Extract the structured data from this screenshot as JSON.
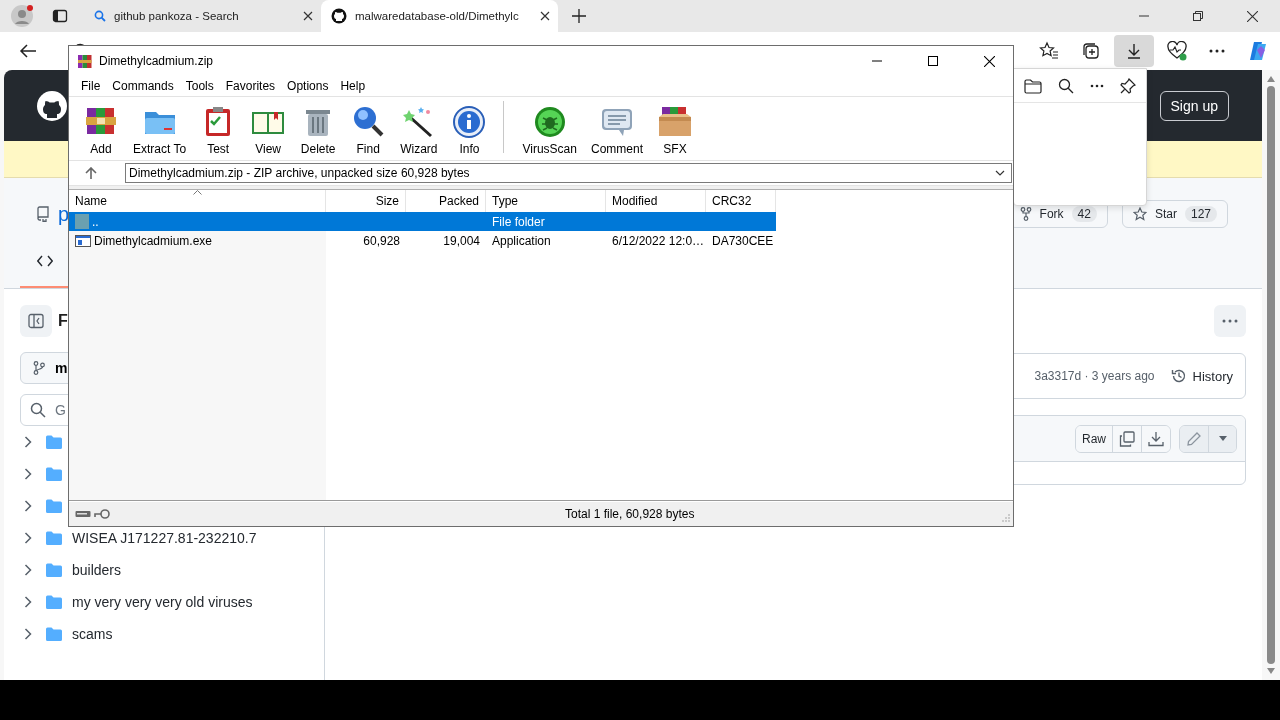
{
  "browser": {
    "tabs": [
      {
        "title": "github pankoza - Search",
        "kind": "search",
        "selected": false
      },
      {
        "title": "malwaredatabase-old/Dimethylc",
        "kind": "github",
        "selected": true
      }
    ],
    "downloads_open": true
  },
  "page": {
    "sign_up": "Sign up",
    "repo_name": "p",
    "fork": {
      "label": "Fork",
      "count": "42"
    },
    "star": {
      "label": "Star",
      "count": "127"
    },
    "files_heading": "F",
    "branch": "m",
    "search_placeholder": "G",
    "tree": [
      {
        "kind": "folder"
      },
      {
        "kind": "folder"
      },
      {
        "kind": "folder"
      },
      {
        "kind": "folder",
        "name": "WISEA J171227.81-232210.7"
      },
      {
        "kind": "folder",
        "name": "builders"
      },
      {
        "kind": "folder",
        "name": "my very very very old viruses"
      },
      {
        "kind": "folder",
        "name": "scams"
      }
    ],
    "commit": "3a3317d · 3 years ago",
    "history": "History",
    "raw": "Raw"
  },
  "winrar": {
    "title": "Dimethylcadmium.zip",
    "menu": [
      "File",
      "Commands",
      "Tools",
      "Favorites",
      "Options",
      "Help"
    ],
    "tools": [
      "Add",
      "Extract To",
      "Test",
      "View",
      "Delete",
      "Find",
      "Wizard",
      "Info"
    ],
    "extra_tools": [
      "VirusScan",
      "Comment",
      "SFX"
    ],
    "path": "Dimethylcadmium.zip - ZIP archive, unpacked size 60,928 bytes",
    "columns": [
      {
        "label": "Name",
        "sorted": true
      },
      {
        "label": "Size",
        "sorted": false
      },
      {
        "label": "Packed",
        "sorted": false
      },
      {
        "label": "Type",
        "sorted": false
      },
      {
        "label": "Modified",
        "sorted": false
      },
      {
        "label": "CRC32",
        "sorted": false
      }
    ],
    "rows": [
      {
        "kind": "folder",
        "name": "..",
        "type": "File folder",
        "selected": true
      },
      {
        "kind": "exe",
        "name": "Dimethylcadmium.exe",
        "size": "60,928",
        "packed": "19,004",
        "type": "Application",
        "modified": "6/12/2022 12:0…",
        "crc": "DA730CEE",
        "selected": false
      }
    ],
    "status": "Total 1 file, 60,928 bytes"
  }
}
